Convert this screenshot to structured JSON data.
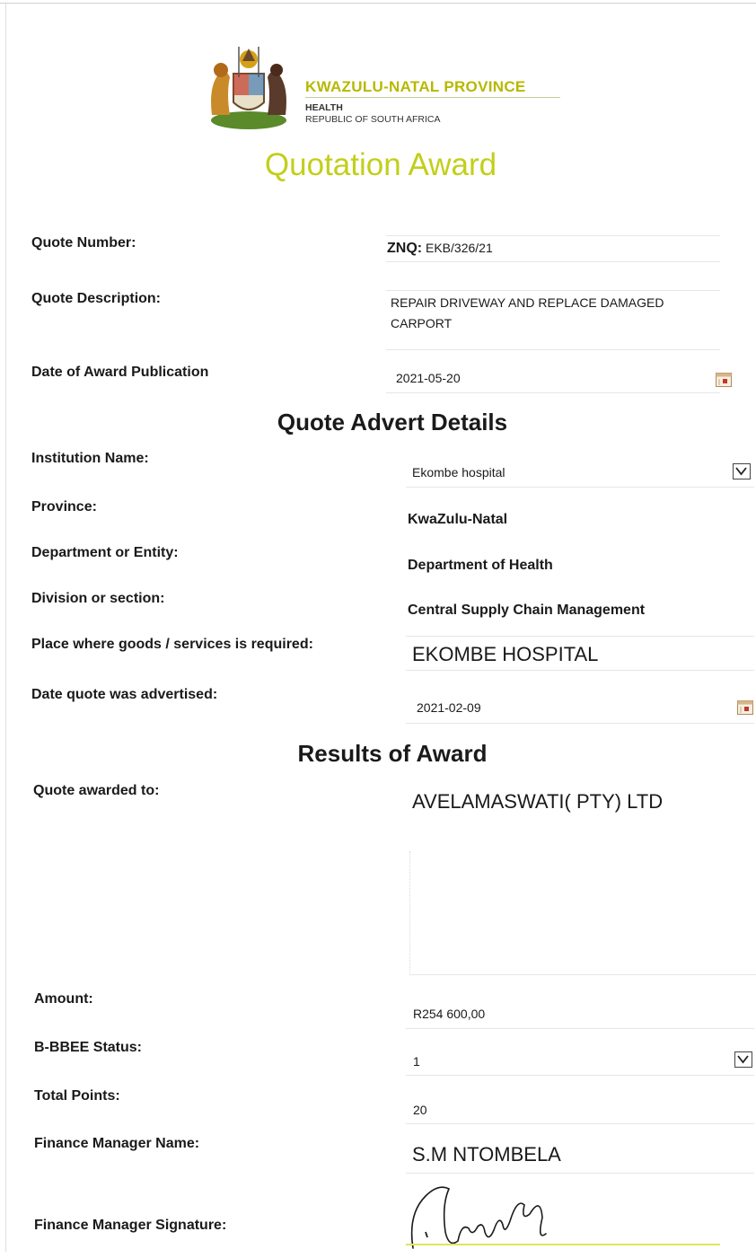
{
  "header": {
    "province": "KWAZULU-NATAL PROVINCE",
    "department": "HEALTH",
    "country": "REPUBLIC OF SOUTH AFRICA",
    "title": "Quotation Award"
  },
  "quote": {
    "number_label": "Quote Number:",
    "number_prefix": "ZNQ:",
    "number_value": "EKB/326/21",
    "description_label": "Quote Description:",
    "description_value": "REPAIR DRIVEWAY AND REPLACE DAMAGED CARPORT",
    "award_date_label": "Date of Award Publication",
    "award_date_value": "2021-05-20"
  },
  "advert": {
    "heading": "Quote Advert Details",
    "institution_label": "Institution Name:",
    "institution_value": "Ekombe hospital",
    "province_label": "Province:",
    "province_value": "KwaZulu-Natal",
    "department_label": "Department or Entity:",
    "department_value": "Department of Health",
    "division_label": "Division or section:",
    "division_value": "Central Supply Chain Management",
    "place_label": "Place where goods /  services is required:",
    "place_value": "EKOMBE HOSPITAL",
    "advertised_label": "Date quote was advertised:",
    "advertised_value": "2021-02-09"
  },
  "results": {
    "heading": "Results of Award",
    "awarded_label": "Quote awarded to:",
    "awarded_value": "AVELAMASWATI( PTY) LTD",
    "amount_label": "Amount:",
    "amount_value": "R254 600,00",
    "bbbee_label": "B-BBEE Status:",
    "bbbee_value": "1",
    "points_label": "Total Points:",
    "points_value": "20",
    "fm_name_label": "Finance Manager Name:",
    "fm_name_value": "S.M NTOMBELA",
    "fm_signature_label": "Finance Manager Signature:"
  },
  "icons": {
    "calendar": "calendar-icon",
    "dropdown": "chevron-down-icon",
    "crest": "coat-of-arms"
  },
  "colors": {
    "title": "#c2cf1a",
    "province": "#b8b800",
    "signature_line": "#e4e45a"
  }
}
